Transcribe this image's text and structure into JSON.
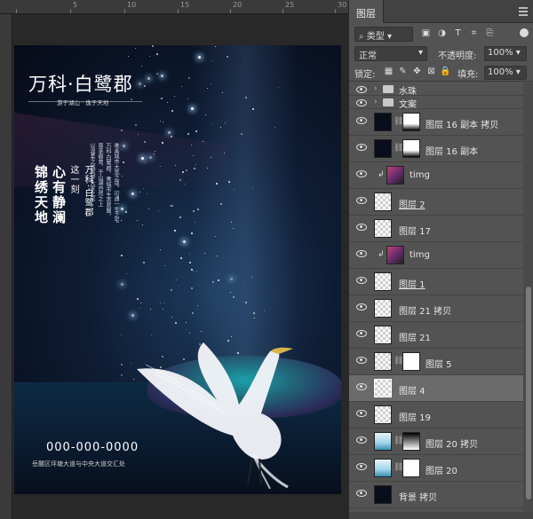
{
  "ruler": {
    "ticks": [
      "5",
      "10",
      "15",
      "20",
      "25",
      "30"
    ]
  },
  "poster": {
    "title": "万科·白鹭郡",
    "subtitle": "游于湖山 · 逸于天地",
    "vertical_lines": [
      "锦绣天地",
      "心有静澜",
      "这一刻",
      "万科·白鹭郡"
    ],
    "small_lines": [
      "唯美城市大宽之境，可遇一生之宅",
      "万科·白鹭郡，奏城市生态蓝图，",
      "尊享都曾，于山湖自然之上",
      "以温柔之城筑梦大家之宅"
    ],
    "phone": "000-000-0000",
    "address": "岳麓区坪塘大道与中央大道交汇处"
  },
  "panel": {
    "tab": "图层",
    "filter": {
      "kind": "类型",
      "icons": [
        "image-filter-icon",
        "adjustment-filter-icon",
        "type-filter-icon",
        "shape-filter-icon",
        "smart-object-filter-icon"
      ]
    },
    "blend_mode": "正常",
    "opacity_label": "不透明度:",
    "opacity_value": "100%",
    "lock_label": "锁定:",
    "fill_label": "填充:",
    "fill_value": "100%"
  },
  "layers": [
    {
      "name": "水珠",
      "type": "group",
      "half": true
    },
    {
      "name": "文案",
      "type": "group",
      "half": true
    },
    {
      "name": "图层 16 副本 拷贝",
      "type": "masked",
      "thumb": "dark",
      "mask": "dark"
    },
    {
      "name": "图层 16 副本",
      "type": "masked",
      "thumb": "dark",
      "mask": "dark"
    },
    {
      "name": "timg",
      "type": "clipped",
      "thumb": "img"
    },
    {
      "name": "图层 2",
      "type": "plain",
      "underline": true
    },
    {
      "name": "图层 17",
      "type": "plain"
    },
    {
      "name": "timg",
      "type": "clipped",
      "thumb": "img"
    },
    {
      "name": "图层 1",
      "type": "plain",
      "underline": true
    },
    {
      "name": "图层 21 拷贝",
      "type": "plain"
    },
    {
      "name": "图层 21",
      "type": "plain"
    },
    {
      "name": "图层 5",
      "type": "masked",
      "mask": "white"
    },
    {
      "name": "图层 4",
      "type": "plain",
      "selected": true
    },
    {
      "name": "图层 19",
      "type": "plain"
    },
    {
      "name": "图层 20 拷贝",
      "type": "masked",
      "thumb": "lake",
      "mask": "grad"
    },
    {
      "name": "图层 20",
      "type": "masked",
      "thumb": "lake",
      "mask": "white"
    },
    {
      "name": "背景 拷贝",
      "type": "plain",
      "thumb": "dark"
    }
  ]
}
